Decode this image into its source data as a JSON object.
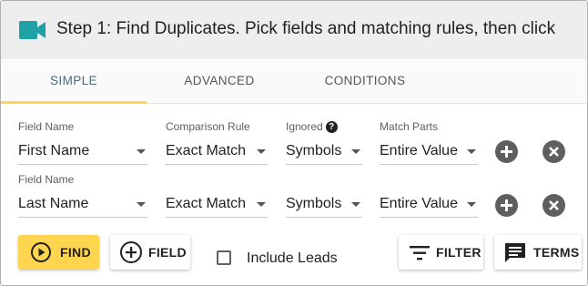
{
  "header": {
    "title": "Step 1: Find Duplicates. Pick fields and matching rules, then click",
    "logo_icon": "video-camera-icon",
    "logo_color": "#20a1a6"
  },
  "tabs": [
    {
      "label": "SIMPLE",
      "active": true
    },
    {
      "label": "ADVANCED",
      "active": false
    },
    {
      "label": "CONDITIONS",
      "active": false
    }
  ],
  "rows": [
    {
      "field_label": "Field Name",
      "field_value": "First Name",
      "rule_label": "Comparison Rule",
      "rule_value": "Exact Match",
      "ignored_label": "Ignored",
      "ignored_value": "Symbols",
      "parts_label": "Match Parts",
      "parts_value": "Entire Value"
    },
    {
      "field_label": "Field Name",
      "field_value": "Last Name",
      "rule_value": "Exact Match",
      "ignored_value": "Symbols",
      "parts_value": "Entire Value"
    }
  ],
  "buttons": {
    "find": "FIND",
    "field": "FIELD",
    "filter": "FILTER",
    "terms": "TERMS"
  },
  "include_leads": {
    "label": "Include Leads",
    "checked": false
  },
  "colors": {
    "accent": "#ffd54f",
    "header_bg": "#eeeeee",
    "tab_active": "#4a6b78"
  }
}
